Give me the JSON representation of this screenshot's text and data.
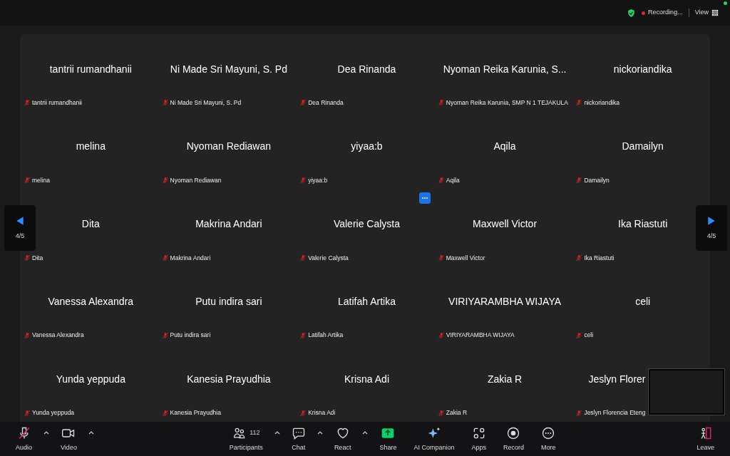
{
  "top_bar": {
    "recording_label": "Recording...",
    "view_label": "View"
  },
  "pager": {
    "previous": "4/5",
    "next": "4/5"
  },
  "gallery": [
    {
      "tiles": [
        {
          "name": "tantrii rumandhanii",
          "label": "tantrii rumandhanii",
          "muted": true
        },
        {
          "name": "Ni Made Sri Mayuni, S. Pd",
          "label": "Ni Made Sri Mayuni, S. Pd",
          "muted": true
        },
        {
          "name": "Dea Rinanda",
          "label": "Dea Rinanda",
          "muted": true
        },
        {
          "name": "Nyoman Reika Karunia, S...",
          "label": "Nyoman Reika Karunia, SMP N 1 TEJAKULA",
          "muted": true
        },
        {
          "name": "nickoriandika",
          "label": "nickoriandika",
          "muted": true
        }
      ]
    },
    {
      "tiles": [
        {
          "name": "melina",
          "label": "melina",
          "muted": true
        },
        {
          "name": "Nyoman Rediawan",
          "label": "Nyoman Rediawan",
          "muted": true
        },
        {
          "name": "yiyaa:b",
          "label": "yiyaa:b",
          "muted": true
        },
        {
          "name": "Aqila",
          "label": "Aqila",
          "muted": true
        },
        {
          "name": "Damailyn",
          "label": "Damailyn",
          "muted": true
        }
      ]
    },
    {
      "tiles": [
        {
          "name": "Dita",
          "label": "Dita",
          "muted": true
        },
        {
          "name": "Makrina Andari",
          "label": "Makrina Andari",
          "muted": true
        },
        {
          "name": "Valerie Calysta",
          "label": "Valerie Calysta",
          "muted": true
        },
        {
          "name": "Maxwell Victor",
          "label": "Maxwell Victor",
          "muted": true
        },
        {
          "name": "Ika Riastuti",
          "label": "Ika Riastuti",
          "muted": true
        }
      ]
    },
    {
      "tiles": [
        {
          "name": "Vanessa Alexandra",
          "label": "Vanessa Alexandra",
          "muted": true
        },
        {
          "name": "Putu indira sari",
          "label": "Putu indira sari",
          "muted": true
        },
        {
          "name": "Latifah Artika",
          "label": "Latifah Artika",
          "muted": true
        },
        {
          "name": "VIRIYARAMBHA WIJAYA",
          "label": "VIRIYARAMBHA WIJAYA",
          "muted": true
        },
        {
          "name": "celi",
          "label": "celi",
          "muted": true
        }
      ]
    },
    {
      "tiles": [
        {
          "name": "Yunda yeppuda",
          "label": "Yunda yeppuda",
          "muted": true
        },
        {
          "name": "Kanesia Prayudhia",
          "label": "Kanesia Prayudhia",
          "muted": true
        },
        {
          "name": "Krisna Adi",
          "label": "Krisna Adi",
          "muted": true
        },
        {
          "name": "Zakia R",
          "label": "Zakia R",
          "muted": true
        },
        {
          "name": "Jeslyn Florer",
          "label": "Jeslyn Florencia Eteng",
          "muted": true
        }
      ]
    }
  ],
  "toolbar": {
    "left": [
      {
        "kind": "audio",
        "label": "Audio",
        "muted": true,
        "menu": true
      },
      {
        "kind": "video",
        "label": "Video",
        "menu": true
      }
    ],
    "center": [
      {
        "kind": "participants",
        "label": "Participants",
        "count": "112",
        "menu": true
      },
      {
        "kind": "chat",
        "label": "Chat",
        "menu": true
      },
      {
        "kind": "react",
        "label": "React",
        "menu": true
      },
      {
        "kind": "share",
        "label": "Share"
      },
      {
        "kind": "ai",
        "label": "AI Companion"
      },
      {
        "kind": "apps",
        "label": "Apps"
      },
      {
        "kind": "record",
        "label": "Record"
      },
      {
        "kind": "more",
        "label": "More"
      }
    ],
    "right": [
      {
        "kind": "leave",
        "label": "Leave"
      }
    ]
  }
}
